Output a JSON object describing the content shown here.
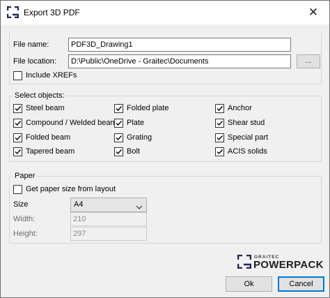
{
  "window": {
    "title": "Export 3D PDF",
    "close_symbol": "✕"
  },
  "file": {
    "name_label": "File name:",
    "name_value": "PDF3D_Drawing1",
    "location_label": "File location:",
    "location_value": "D:\\Public\\OneDrive - Graitec\\Documents",
    "browse_label": "...",
    "include_xrefs_label": "Include XREFs",
    "include_xrefs_checked": false
  },
  "select_objects": {
    "legend": "Select objects:",
    "items": [
      {
        "label": "Steel beam",
        "checked": true
      },
      {
        "label": "Folded plate",
        "checked": true
      },
      {
        "label": "Anchor",
        "checked": true
      },
      {
        "label": "Compound / Welded beam",
        "checked": true
      },
      {
        "label": "Plate",
        "checked": true
      },
      {
        "label": "Shear stud",
        "checked": true
      },
      {
        "label": "Folded beam",
        "checked": true
      },
      {
        "label": "Grating",
        "checked": true
      },
      {
        "label": "Special part",
        "checked": true
      },
      {
        "label": "Tapered beam",
        "checked": true
      },
      {
        "label": "Bolt",
        "checked": true
      },
      {
        "label": "ACIS solids",
        "checked": true
      }
    ]
  },
  "paper": {
    "legend": "Paper",
    "layout_label": "Get paper size from layout",
    "layout_checked": false,
    "size_label": "Size",
    "size_value": "A4",
    "width_label": "Width:",
    "width_value": "210",
    "height_label": "Height:",
    "height_value": "297"
  },
  "brand": {
    "top": "GRAITEC",
    "main": "POWERPACK",
    "color": "#1e2a5a"
  },
  "buttons": {
    "ok": "Ok",
    "cancel": "Cancel"
  },
  "colors": {
    "accent": "#0078d7"
  }
}
